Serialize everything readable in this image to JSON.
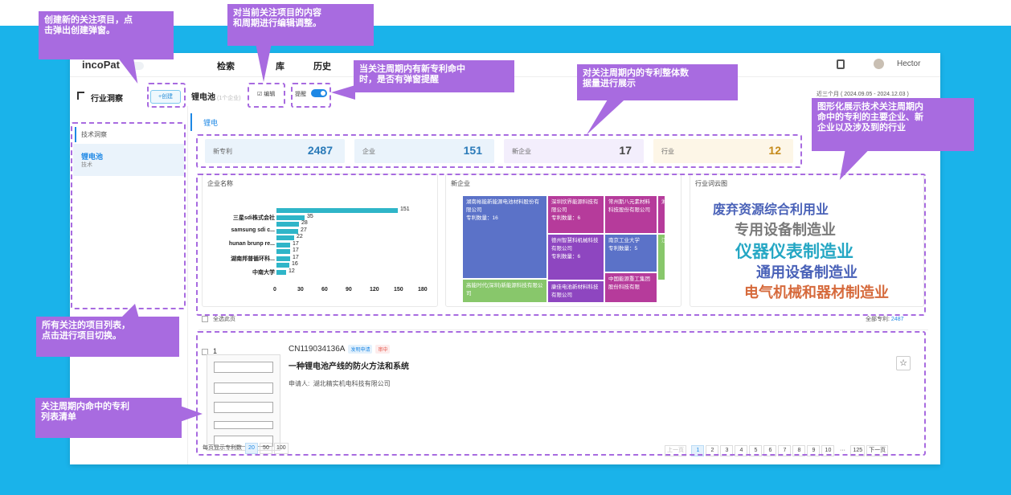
{
  "app": {
    "logo": "incoPat",
    "nav": [
      "检索",
      "库",
      "历史"
    ],
    "user": "Hector"
  },
  "toolbar": {
    "title": "行业洞察",
    "new_label": "+创建",
    "project": "锂电池",
    "project_sub": "(1个企业)",
    "edit_label": "编辑",
    "remind_label": "提醒",
    "date_range": "近三个月 ( 2024.09.05 - 2024.12.03 )"
  },
  "sidebar": {
    "header": "技术洞察",
    "item_name": "锂电池",
    "item_sub": "技术"
  },
  "tab": "锂电",
  "stats": [
    {
      "label": "新专利",
      "value": "2487",
      "color": "#2a7ab8",
      "bg": "#eaf3fb"
    },
    {
      "label": "企业",
      "value": "151",
      "color": "#2a7ab8",
      "bg": "#eaf3fb"
    },
    {
      "label": "新企业",
      "value": "17",
      "color": "#444",
      "bg": "#f3eefc"
    },
    {
      "label": "行业",
      "value": "12",
      "color": "#c58a1a",
      "bg": "#fdf6e7"
    }
  ],
  "enterprise_chart": {
    "title": "企业名称",
    "labels": [
      "三星sdi株式会社",
      "",
      "samsung sdi c...",
      "",
      "hunan brunp re...",
      "",
      "湖南邦普循环科...",
      "",
      "中南大学"
    ],
    "values": [
      151,
      35,
      28,
      27,
      22,
      17,
      17,
      17,
      16,
      12
    ],
    "xticks": [
      "0",
      "30",
      "60",
      "90",
      "120",
      "150",
      "180"
    ]
  },
  "new_enterprise": {
    "title": "新企业",
    "cells": [
      {
        "text": "湖南裕能新能源电池材料股份有限公司\n专利数量：16",
        "color": "#5b72c8"
      },
      {
        "text": "深圳欣界能源科技有限公司\n专利数量：6",
        "color": "#b63b9b"
      },
      {
        "text": "常州斯八元素材料科技股份有限公司",
        "color": "#b63b9b"
      },
      {
        "text": "湘",
        "color": "#b63b9b"
      },
      {
        "text": "德州智慧科机械科技有限公司\n专利数量：6",
        "color": "#8e46c0"
      },
      {
        "text": "南京工业大学\n专利数量：5",
        "color": "#5b72c8"
      },
      {
        "text": "江",
        "color": "#88c76b"
      },
      {
        "text": "高能时代(深圳)新能源科技有限公司",
        "color": "#88c76b"
      },
      {
        "text": "康佳电池新材料科技有限公司",
        "color": "#8e46c0"
      },
      {
        "text": "中国能源重工集团股份科技有限",
        "color": "#b63b9b"
      }
    ]
  },
  "industry_cloud": {
    "title": "行业词云图",
    "words": [
      {
        "text": "废弃资源综合利用业",
        "color": "#4a62b8"
      },
      {
        "text": "专用设备制造业",
        "color": "#7a7a7a"
      },
      {
        "text": "仪器仪表制造业",
        "color": "#25a7c4"
      },
      {
        "text": "通用设备制造业",
        "color": "#4a62b8"
      },
      {
        "text": "电气机械和器材制造业",
        "color": "#d66a3c"
      }
    ]
  },
  "list": {
    "select_all": "全选此页",
    "total_label": "全部专利:",
    "total": "2487"
  },
  "patent": {
    "index": "1",
    "number": "CN119034136A",
    "badge1": "发明申请",
    "badge2": "审中",
    "title": "一种锂电池产线的防火方法和系统",
    "applicant_label": "申请人:",
    "applicant": "湖北精实机电科技有限公司"
  },
  "pagination": {
    "per_page_label": "每页显示专利数",
    "sizes": [
      "20",
      "50",
      "100"
    ],
    "prev": "上一页",
    "pages": [
      "1",
      "2",
      "3",
      "4",
      "5",
      "6",
      "7",
      "8",
      "9",
      "10",
      "···",
      "125"
    ],
    "next": "下一页"
  },
  "annotations": [
    "创建新的关注项目，点\n击弹出创建弹窗。",
    "对当前关注项目的内容\n和周期进行编辑调整。",
    "当关注周期内有新专利命中\n时，是否有弹窗提醒",
    "对关注周期内的专利整体数\n据量进行展示",
    "图形化展示技术关注周期内\n命中的专利的主要企业、新\n企业以及涉及到的行业",
    "所有关注的项目列表，\n点击进行项目切换。",
    "关注周期内命中的专利\n列表清单"
  ]
}
